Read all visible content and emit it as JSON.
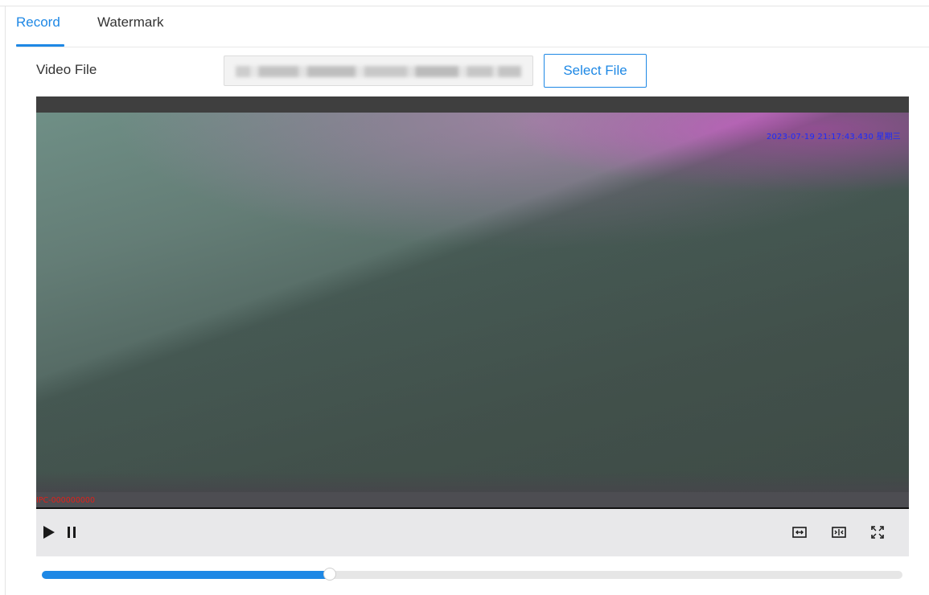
{
  "tabs": [
    {
      "label": "Record",
      "active": true
    },
    {
      "label": "Watermark",
      "active": false
    }
  ],
  "video_file": {
    "label": "Video File",
    "select_button": "Select File"
  },
  "player": {
    "osd_timestamp": "2023-07-19 21:17:43.430 星期三",
    "osd_channel": "IPC-000000000",
    "progress_fraction": 0.335,
    "controls": {
      "play_icon": "play-icon",
      "pause_icon": "pause-icon",
      "fit_icon": "fit-to-window-icon",
      "original_size_icon": "original-size-icon",
      "fullscreen_icon": "fullscreen-icon"
    }
  },
  "colors": {
    "accent": "#1e88e5",
    "osd_time": "#1a2bff",
    "osd_channel": "#e0201a"
  }
}
